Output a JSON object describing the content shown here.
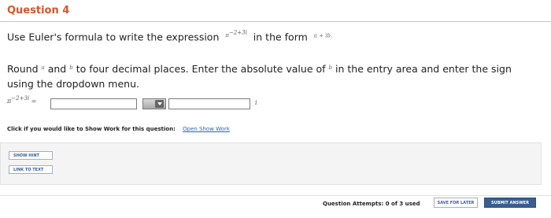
{
  "question": {
    "title": "Question 4",
    "line1_prefix": "Use Euler's formula to write the expression",
    "expression_base": "π",
    "expression_exp": "−2+3i",
    "line1_middle": "in the form",
    "form": "a + ib",
    "line1_end": ".",
    "line2_part1": "Round",
    "var_a": "a",
    "line2_part2": "and",
    "var_b": "b",
    "line2_part3": "to four decimal places. Enter the absolute value of",
    "var_b2": "b",
    "line2_part4": "in the entry area and enter the sign",
    "line3": "using the dropdown menu."
  },
  "answer": {
    "lhs_base": "π",
    "lhs_exp": "−2+3i",
    "lhs_equals": "=",
    "input_a_value": "",
    "sign_value": "",
    "input_b_value": "",
    "i_suffix": "i"
  },
  "show_work": {
    "label": "Click if you would like to Show Work for this question:",
    "link": "Open Show Work"
  },
  "buttons": {
    "show_hint": "SHOW HINT",
    "link_to_text": "LINK TO TEXT",
    "save_for_later": "SAVE FOR LATER",
    "submit_answer": "SUBMIT ANSWER"
  },
  "footer": {
    "attempts": "Question Attempts: 0 of 3 used"
  },
  "colors": {
    "title": "#d9542b",
    "link": "#2a67b5",
    "submit_bg": "#3b5e8e"
  }
}
